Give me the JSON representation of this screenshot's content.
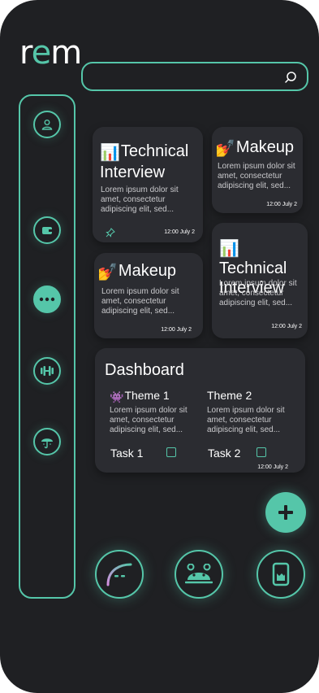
{
  "app": {
    "logo_prefix": "r",
    "logo_accent": "e",
    "logo_suffix": "m"
  },
  "search": {
    "placeholder": "",
    "value": ""
  },
  "colors": {
    "accent": "#55c6a9",
    "background": "#1f2023",
    "card": "#2b2c31"
  },
  "sidebar": {
    "items": [
      {
        "icon": "user-icon"
      },
      {
        "icon": "wallet-icon"
      },
      {
        "icon": "more-icon"
      },
      {
        "icon": "dumbbell-icon"
      },
      {
        "icon": "umbrella-icon"
      }
    ]
  },
  "notes": [
    {
      "emoji": "📊",
      "title": "Technical Interview",
      "body": "Lorem ipsum dolor sit amet, consectetur adipiscing elit, sed...",
      "date": "12:00 July 2",
      "pinned": true
    },
    {
      "emoji": "💅",
      "title": "Makeup",
      "body": "Lorem ipsum dolor sit amet, consectetur adipiscing elit, sed...",
      "date": "12:00 July 2"
    },
    {
      "emoji": "💅",
      "title": "Makeup",
      "body": "Lorem ipsum dolor sit amet, consectetur adipiscing elit, sed...",
      "date": "12:00 July 2"
    },
    {
      "emoji": "📊",
      "title": "Technical Interview",
      "body": "Lorem ipsum dolor sit amet, consectetur adipiscing elit, sed...",
      "date": "12:00 July 2"
    }
  ],
  "dashboard": {
    "title": "Dashboard",
    "themes": [
      {
        "emoji": "👾",
        "title": "Theme 1",
        "body": "Lorem ipsum dolor sit amet, consectetur adipiscing elit, sed...",
        "task": "Task 1"
      },
      {
        "emoji": "",
        "title": "Theme 2",
        "body": "Lorem ipsum dolor sit amet, consectetur adipiscing elit, sed...",
        "task": "Task 2"
      }
    ],
    "date": "12:00 July 2"
  },
  "fab": {
    "icon": "plus-icon"
  },
  "bottom_nav": [
    {
      "icon": "gauge-icon"
    },
    {
      "icon": "android-icon"
    },
    {
      "icon": "card-icon"
    }
  ]
}
